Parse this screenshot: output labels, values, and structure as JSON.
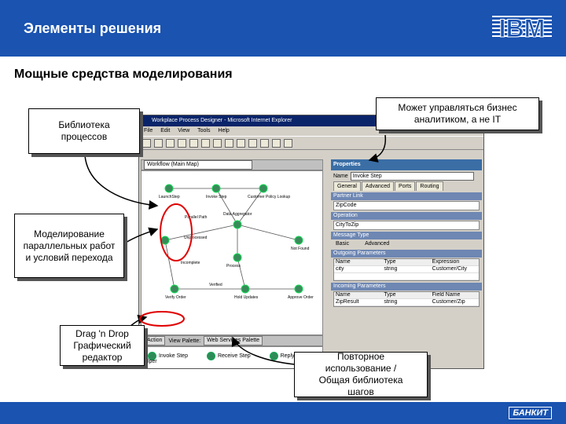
{
  "header": {
    "title": "Элементы решения",
    "logo_text": "IBM"
  },
  "subtitle": "Мощные средства моделирования",
  "callouts": {
    "library": "Библиотека процессов",
    "business": "Может управляться бизнес аналитиком, а не IT",
    "modeling": "Моделирование параллельных работ и условий перехода",
    "dragdrop": "Drag 'n Drop Графический редактор",
    "reuse": "Повторное использование / Общая библиотека шагов"
  },
  "window": {
    "title": "Workplace Process Designer - Microsoft Internet Explorer",
    "menu": [
      "File",
      "Edit",
      "View",
      "Tools",
      "Help"
    ],
    "workflow_select": "Workflow (Main Map)",
    "nodes": [
      "LaunchStep",
      "Invoke Step",
      "Customer Policy Lookup",
      "Data Aggregator",
      "Parallel Path",
      "Unprocessed",
      "Process",
      "Not Found",
      "Incomplete",
      "Verify Order",
      "Verified",
      "Hold Updates",
      "Approve Order"
    ],
    "palette_tab_action": "Action",
    "palette_label": "View Palette:",
    "palette_select": "Web Services Palette",
    "palette_items": [
      "Invoke Step",
      "Receive Step",
      "Reply Step"
    ],
    "status": "Helper"
  },
  "properties": {
    "title": "Properties",
    "name_label": "Name",
    "name_value": "Invoke Step",
    "tabs": [
      "General",
      "Advanced",
      "Ports",
      "Routing"
    ],
    "sections": {
      "partner_link": "Partner Link",
      "partner_value": "ZipCode",
      "operation": "Operation",
      "operation_value": "CityToZip",
      "message_type": "Message Type",
      "outgoing": "Outgoing Parameters",
      "incoming": "Incoming Parameters"
    },
    "radio": [
      "Basic",
      "Advanced"
    ],
    "table_head": [
      "Name",
      "Type",
      "Expression"
    ],
    "outgoing_row": [
      "city",
      "string",
      "Customer/City"
    ],
    "incoming_head": [
      "Name",
      "Type",
      "Field Name"
    ],
    "incoming_row": [
      "ZipResult",
      "string",
      "Customer/Zip"
    ]
  },
  "footer": {
    "logo_text": "БАНКИТ"
  },
  "colors": {
    "brand": "#1a53b0",
    "highlight": "#e00000"
  }
}
